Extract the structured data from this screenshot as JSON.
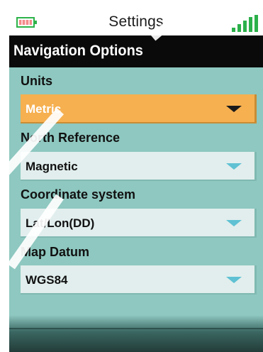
{
  "statusbar": {
    "title": "Settings",
    "battery_icon": "battery-icon",
    "signal_icon": "signal-strength-icon",
    "accent_color": "#2bb04a"
  },
  "header": {
    "title": "Navigation Options"
  },
  "fields": [
    {
      "label": "Units",
      "value": "Metric",
      "selected": true
    },
    {
      "label": "North Reference",
      "value": "Magnetic",
      "selected": false
    },
    {
      "label": "Coordinate system",
      "value": "Lat/Lon(DD)",
      "selected": false
    },
    {
      "label": "Map Datum",
      "value": "WGS84",
      "selected": false
    }
  ],
  "colors": {
    "background": "#8ec8c0",
    "selected_field": "#f6b050",
    "field": "#e1eeed",
    "header": "#0a0a0a",
    "arrow": "#5fc1d3"
  }
}
